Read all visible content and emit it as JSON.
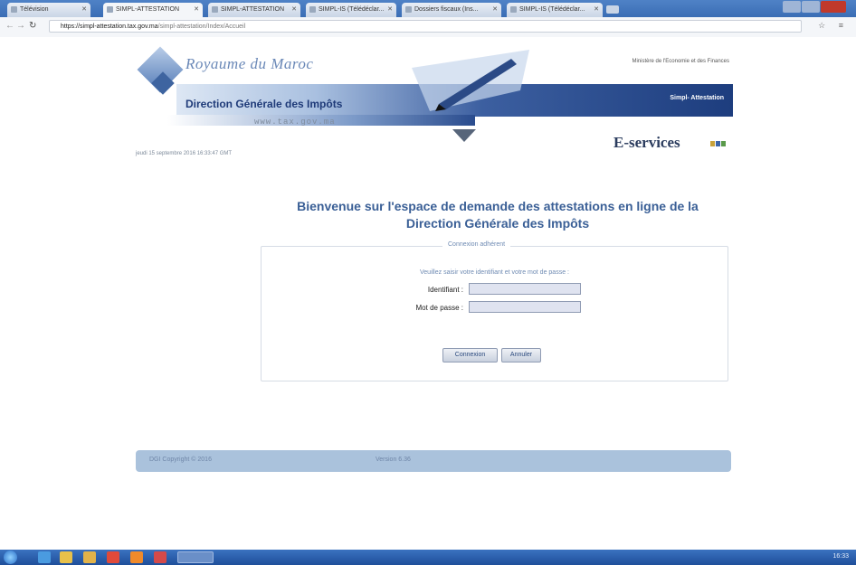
{
  "browser": {
    "tabs": [
      {
        "label": "Télévision"
      },
      {
        "label": "SIMPL-ATTESTATION"
      },
      {
        "label": "SIMPL-ATTESTATION"
      },
      {
        "label": "SIMPL-IS (Télédéclar..."
      },
      {
        "label": "Dossiers fiscaux (Ins..."
      },
      {
        "label": "SIMPL-IS (Télédéclar..."
      }
    ],
    "url_host": "https://simpl-attestation.tax.gov.ma",
    "url_path": "/simpl-attestation/Index/Accueil"
  },
  "header": {
    "kingdom": "Royaume du Maroc",
    "ministry": "Ministère de l'Economie et des Finances",
    "dgi": "Direction Générale des Impôts",
    "website": "www.tax.gov.ma",
    "badge": "Simpl- Attestation",
    "eservices": "E-services",
    "datetime": "jeudi 15 septembre 2016 16:33:47 GMT"
  },
  "welcome": {
    "line1": "Bienvenue sur l'espace de demande des attestations en ligne de la",
    "line2": "Direction Générale des Impôts"
  },
  "login": {
    "legend": "Connexion adhérent",
    "instruction": "Veuillez saisir votre identifiant et votre mot de passe :",
    "id_label": "Identifiant :",
    "id_value": "",
    "pwd_label": "Mot de passe :",
    "pwd_value": "",
    "connect_button": "Connexion",
    "cancel_button": "Annuler"
  },
  "footer": {
    "copyright": "DGI Copyright © 2016",
    "version": "Version 6.36"
  },
  "colors": {
    "accent": "#3a5f96",
    "footer_bg": "#aac2dc",
    "taskbar": "#2a5da8"
  },
  "taskbar": {
    "icons": [
      "ie-icon",
      "explorer-icon",
      "folder-icon",
      "acrobat-icon",
      "firefox-icon",
      "media-icon",
      "chrome-icon"
    ],
    "clock": "16:33"
  }
}
